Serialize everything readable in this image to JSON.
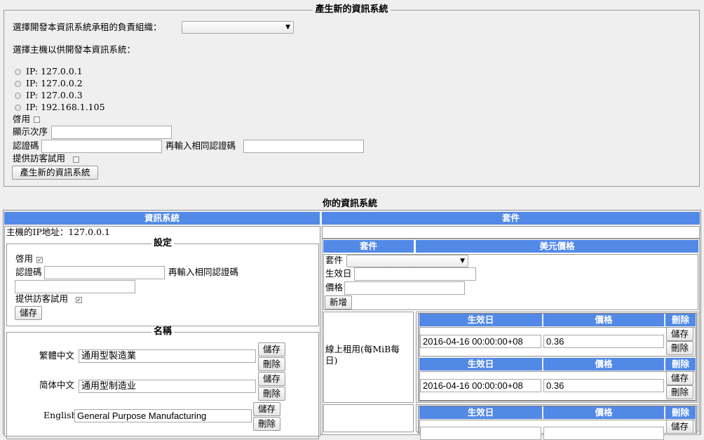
{
  "create_form": {
    "title": "產生新的資訊系統",
    "org_label": "選擇開發本資訊系統承租的負責組織：",
    "org_selected": "",
    "host_label": "選擇主機以供開發本資訊系統：",
    "hosts": [
      "IP: 127.0.0.1",
      "IP: 127.0.0.2",
      "IP: 127.0.0.3",
      "IP: 192.168.1.105"
    ],
    "enable_label": "啓用",
    "display_order_label": "顯示次序",
    "password_label": "認證碼",
    "password_confirm_label": "再輸入相同認證碼",
    "guest_trial_label": "提供訪客試用",
    "submit_label": "產生新的資訊系統"
  },
  "your_systems": {
    "title": "你的資訊系統",
    "col_system": "資訊系統",
    "col_packages": "套件",
    "host_ip_text": "主機的IP地址：127.0.0.1",
    "settings": {
      "title": "設定",
      "enable_label": "啓用",
      "enabled": true,
      "password_label": "認證碼",
      "password_confirm_label": "再輸入相同認證碼",
      "guest_trial_label": "提供訪客試用",
      "guest_trial": true,
      "save_label": "儲存"
    },
    "names": {
      "title": "名稱",
      "save_label": "儲存",
      "delete_label": "刪除",
      "rows": [
        {
          "lang": "繁體中文",
          "value": "通用型製造業"
        },
        {
          "lang": "简体中文",
          "value": "通用型制造业"
        },
        {
          "lang": "English",
          "value": "General Purpose Manufacturing"
        }
      ]
    },
    "packages": {
      "header_package": "套件",
      "header_price": "美元價格",
      "package_label": "套件",
      "package_selected": "",
      "effective_date_label": "生效日",
      "price_label": "價格",
      "add_label": "新增",
      "online_rent_label": "線上租用(每MiB每日)",
      "price_table": {
        "col_effective": "生效日",
        "col_price": "價格",
        "col_delete": "刪除",
        "save_label": "儲存",
        "delete_label": "刪除",
        "rows": [
          {
            "effective": "2016-04-16 00:00:00+08",
            "price": "0.36"
          },
          {
            "effective": "2016-04-16 00:00:00+08",
            "price": "0.36"
          },
          {
            "effective": "",
            "price": ""
          }
        ]
      }
    }
  }
}
